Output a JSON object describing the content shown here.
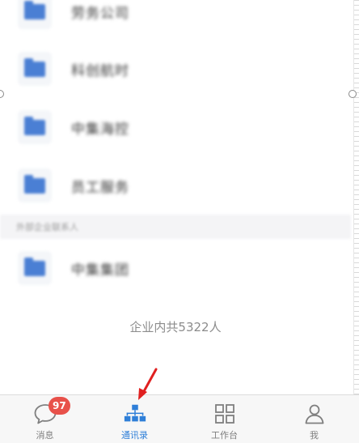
{
  "org_list": {
    "items": [
      {
        "label": "劳务公司"
      },
      {
        "label": "科创航时"
      },
      {
        "label": "中集海控"
      },
      {
        "label": "员工服务"
      }
    ],
    "section_header": "外部企业联系人",
    "section_items": [
      {
        "label": "中集集团"
      }
    ],
    "summary": "企业内共5322人"
  },
  "tabbar": {
    "tabs": [
      {
        "label": "消息",
        "icon": "chat-bubble-icon",
        "badge": "97"
      },
      {
        "label": "通讯录",
        "icon": "org-chart-icon",
        "active": true
      },
      {
        "label": "工作台",
        "icon": "grid-icon"
      },
      {
        "label": "我",
        "icon": "person-icon"
      }
    ]
  },
  "colors": {
    "accent": "#2f7fd8",
    "badge": "#e8514a",
    "folder": "#4a7fd4",
    "arrow": "#e02020"
  }
}
